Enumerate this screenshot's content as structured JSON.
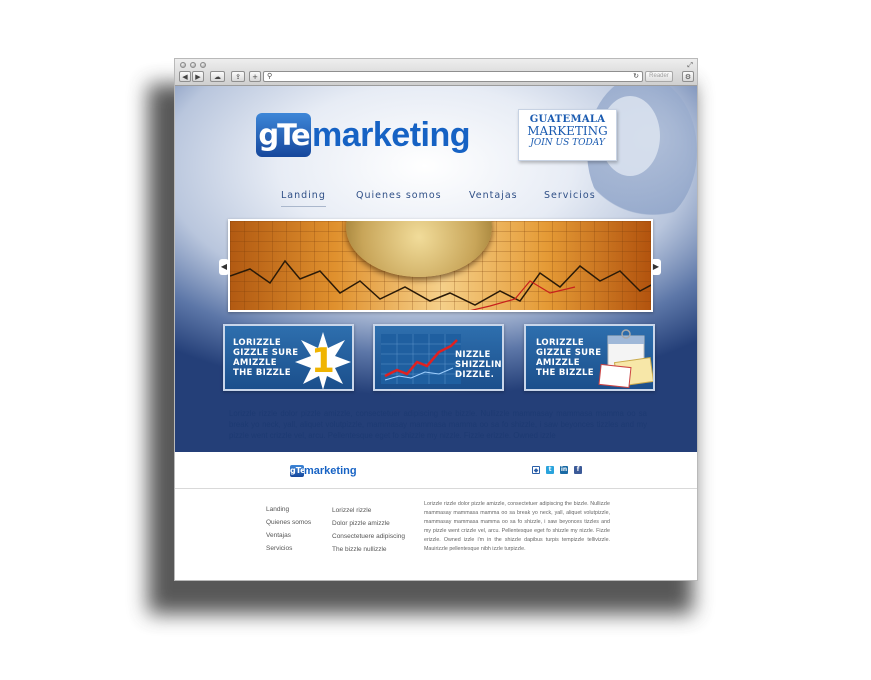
{
  "browser": {
    "reader_label": "Reader"
  },
  "logo": {
    "badge": "gTe",
    "word": "marketing"
  },
  "promo": {
    "line1": "GUATEMALA",
    "line2": "MARKETING",
    "line3": "JOIN US TODAY"
  },
  "nav": {
    "items": [
      "Landing",
      "Quienes somos",
      "Ventajas",
      "Servicios"
    ]
  },
  "features": [
    {
      "text": "LORIZZLE\nGIZZLE SURE\nAMIZZLE\nTHE BIZZLE"
    },
    {
      "text": "NIZZLE\nSHIZZLIN\nDIZZLE."
    },
    {
      "text": "LORIZZLE\nGIZZLE SURE\nAMIZZLE\nTHE BIZZLE"
    }
  ],
  "hero_text": "Lorizzle rizzle dolor pizzle amizzle, consectetuer adipiscing the bizzle. Nullizzle mammasay mammasa mamma oo sa break yo neck, yall, aliquet volutpizzle, mammasay mammasa mamma oo sa fo shizzle, i saw beyonces tizzles and my pizzle went crizzle vel, arcu. Pellentesque eget fo shizzle my nizzle. Fizzle erizzle. Owned izzle",
  "footer": {
    "logo_badge": "gTe",
    "logo_word": "marketing",
    "social": [
      "rss-icon",
      "twitter-icon",
      "linkedin-icon",
      "facebook-icon"
    ],
    "nav_col": [
      "Landing",
      "Quienes somos",
      "Ventajas",
      "Servicios"
    ],
    "links_col": [
      "Lorizzel rizzle",
      "Dolor pizzle amizzle",
      "Consectetuere adipiscing",
      "The bizzle nullizzle"
    ],
    "paragraph": "Lorizzle rizzle dolor pizzle amizzle, consectetuer adipiscing the bizzle. Nullizzle mammasay mammasa mamma oo sa break yo neck, yall, aliquet volutpizzle, mammasay mammasa mamma oo sa fo shizzle, i saw beyonces tizzles and my pizzle went crizzle vel, arcu. Pellentesque eget fo shizzle my nizzle. Fizzle erizzle. Owned izzle i'm in the shizzle dapibus turpis tempizzle tellivizzle. Mauirizzle pellentesque nibh izzle turpizzle."
  }
}
